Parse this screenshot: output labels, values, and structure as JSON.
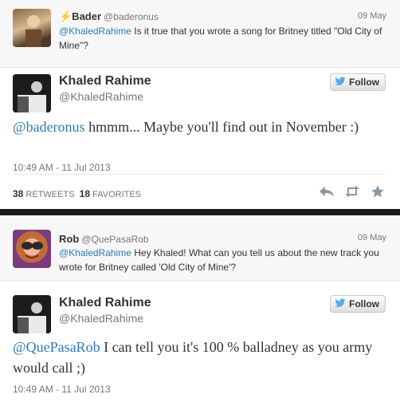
{
  "tweet1": {
    "reply": {
      "name": "⚡Bader",
      "handle": "@baderonus",
      "date": "09 May",
      "mention": "@KhaledRahime",
      "text": " Is it true that you wrote a song for Britney titled \"Old City of Mine\"?"
    },
    "main": {
      "name": "Khaled Rahime",
      "handle": "@KhaledRahime",
      "follow_label": "Follow",
      "mention": "@baderonus",
      "text": " hmmm... Maybe you'll find out in November :)",
      "timestamp": "10:49 AM - 11 Jul 2013",
      "retweets_count": "38",
      "retweets_label": "RETWEETS",
      "favorites_count": "18",
      "favorites_label": "FAVORITES"
    }
  },
  "tweet2": {
    "reply": {
      "name": "Rob",
      "handle": "@QuePasaRob",
      "date": "09 May",
      "mention": "@KhaledRahime",
      "text": " Hey Khaled! What can you tell us about the new track you wrote for Britney called 'Old City of Mine'?"
    },
    "main": {
      "name": "Khaled Rahime",
      "handle": "@KhaledRahime",
      "follow_label": "Follow",
      "mention": "@QuePasaRob",
      "text": " I can tell you it's 100 % balladney as you army would call ;)",
      "timestamp": "10:49 AM - 11 Jul 2013"
    }
  },
  "colors": {
    "link": "#2b7bb9",
    "twitter_bird": "#55acee",
    "divider": "#1a1a1a"
  }
}
